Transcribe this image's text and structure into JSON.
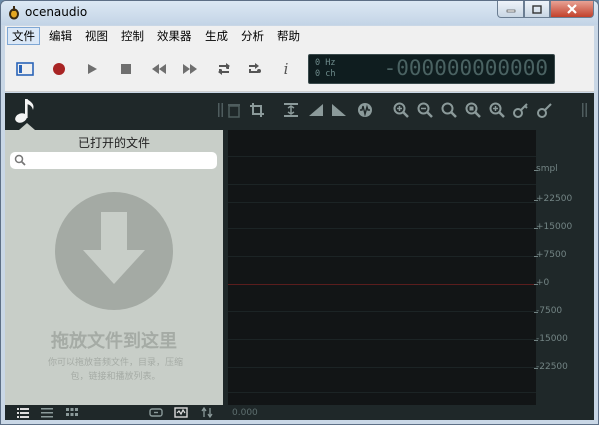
{
  "app": {
    "title": "ocenaudio",
    "colors": {
      "titlebar": "#c9d7e6",
      "dark_panel": "#1f2829",
      "waveform_bg": "#121516",
      "sidebar_bg": "#c8cec8",
      "zero_line": "#5a1d1d"
    }
  },
  "window_controls": {
    "min_icon": "minimize-icon",
    "max_icon": "maximize-icon",
    "close_icon": "close-icon"
  },
  "menu": {
    "items": [
      "文件",
      "编辑",
      "视图",
      "控制",
      "效果器",
      "生成",
      "分析",
      "帮助"
    ],
    "active_index": 0
  },
  "toolbar": {
    "buttons": [
      "sidebar-toggle-icon",
      "record-icon",
      "play-icon",
      "stop-icon",
      "rewind-icon",
      "fast-forward-icon",
      "loop-icon",
      "loop-selection-icon",
      "info-icon"
    ],
    "info_label": "i"
  },
  "display": {
    "hz": "0 Hz",
    "ch": "0 ch",
    "time": "-000000000000"
  },
  "tools": [
    "drag-handle-icon",
    "delete-icon",
    "crop-icon",
    "normalize-icon",
    "fade-in-icon",
    "fade-out-icon",
    "effect-icon",
    "zoom-in-icon",
    "zoom-out-icon",
    "zoom-fit-icon",
    "zoom-selection-icon",
    "zoom-full-icon",
    "key-icon",
    "key-alt-icon"
  ],
  "sidebar": {
    "heading": "已打开的文件",
    "search_placeholder": "",
    "drop_title": "拖放文件到这里",
    "drop_hint": "你可以拖放音频文件，目录，压缩包，链接和播放列表。",
    "footer_icons": [
      "list-detail-icon",
      "list-compact-icon",
      "grid-icon",
      "link-icon",
      "waveform-icon",
      "sort-icon"
    ]
  },
  "ruler": {
    "unit": "smpl",
    "ticks": [
      "+22500",
      "+15000",
      "+7500",
      "+0",
      "-7500",
      "-15000",
      "-22500"
    ]
  },
  "position": {
    "value": "0.000"
  }
}
